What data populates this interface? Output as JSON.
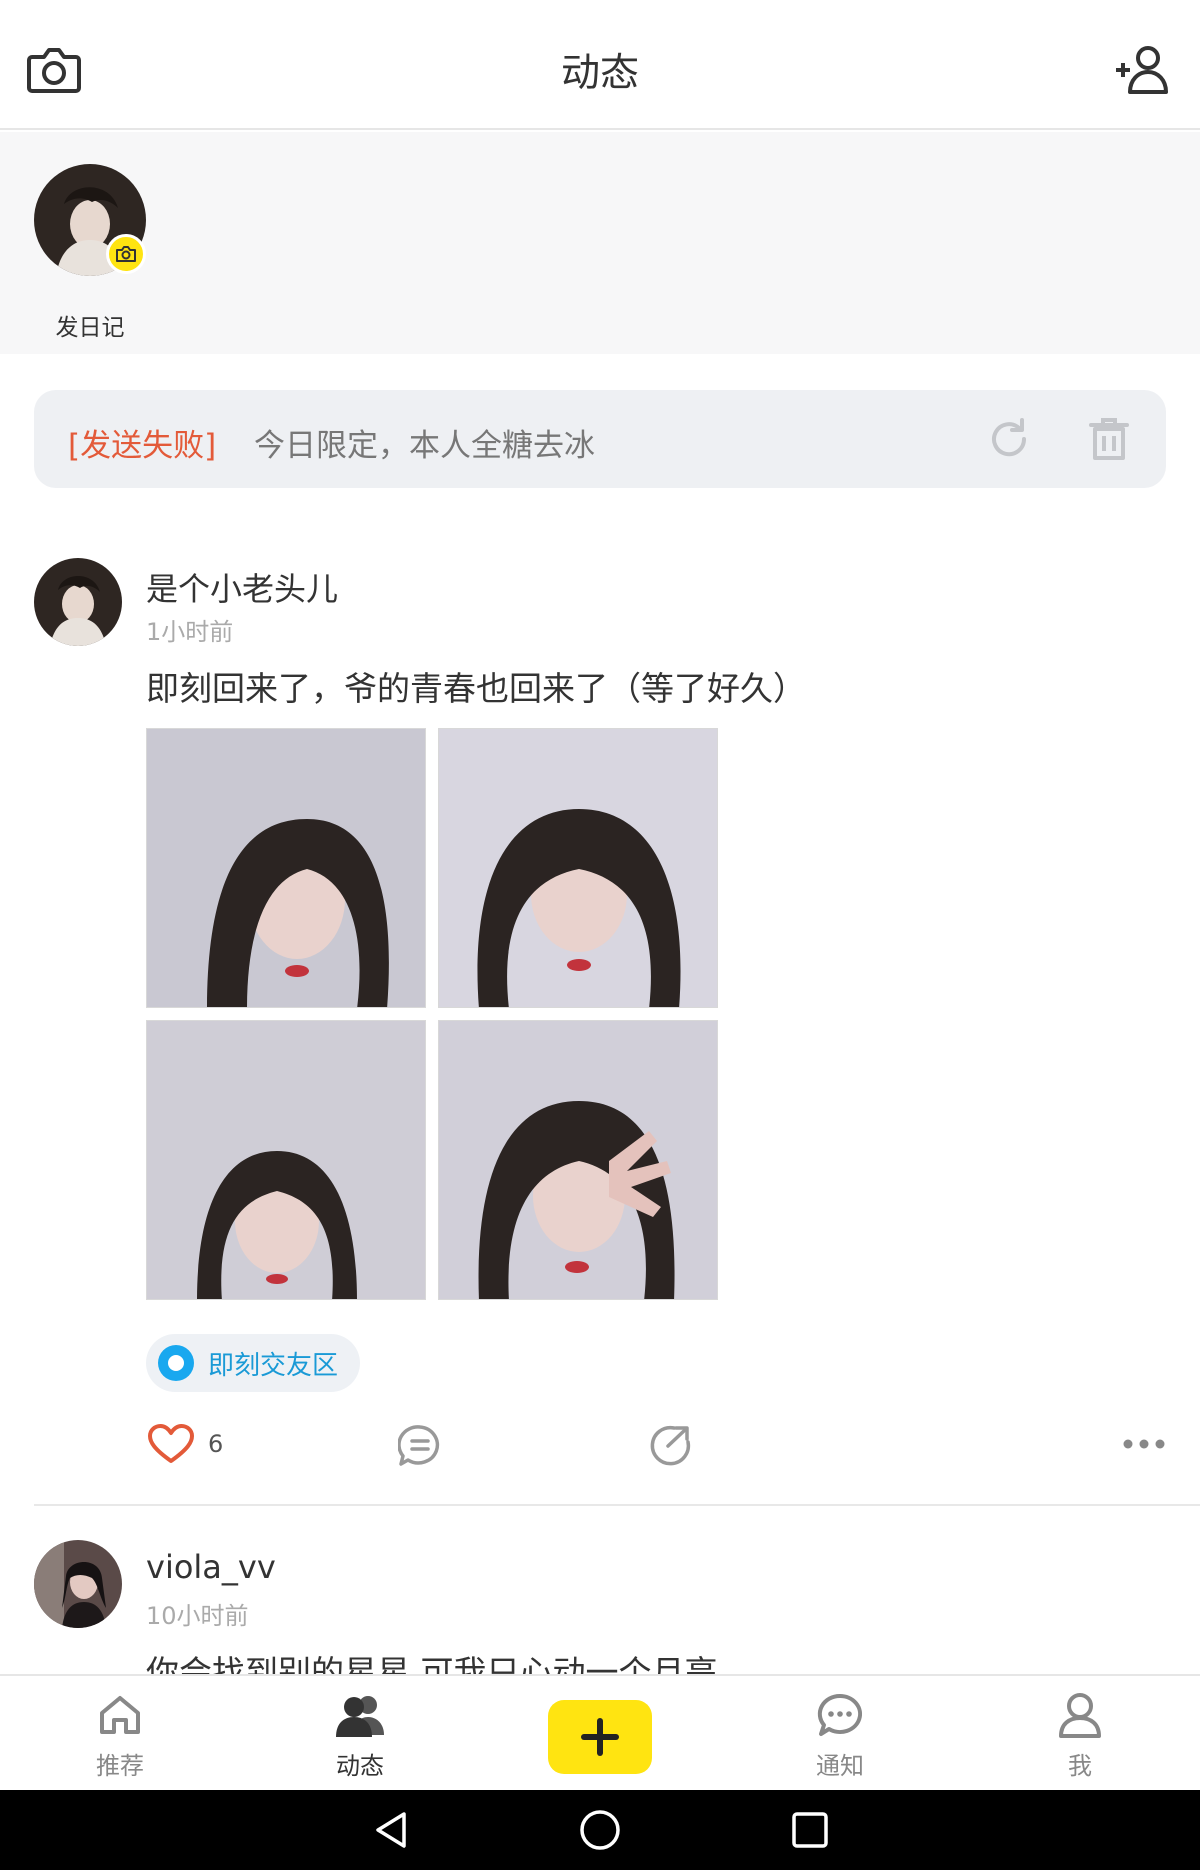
{
  "header": {
    "title": "动态"
  },
  "stories": {
    "label": "发日记"
  },
  "failed_post": {
    "tag": "[发送失败]",
    "message": "今日限定，本人全糖去冰"
  },
  "posts": [
    {
      "username": "是个小老头儿",
      "time": "1小时前",
      "text": "即刻回来了，爷的青春也回来了（等了好久）",
      "topic": "即刻交友区",
      "likes": "6",
      "image_count": 4
    },
    {
      "username": "viola_vv",
      "time": "10小时前",
      "text": "你会找到别的星星 可我只心动一个月亮"
    }
  ],
  "tabs": [
    {
      "label": "推荐",
      "icon": "home-icon"
    },
    {
      "label": "动态",
      "icon": "people-icon"
    },
    {
      "label": "",
      "icon": "plus-icon"
    },
    {
      "label": "通知",
      "icon": "chat-bubble-icon"
    },
    {
      "label": "我",
      "icon": "person-icon"
    }
  ],
  "colors": {
    "accent_yellow": "#ffe411",
    "error_red": "#e35a39",
    "topic_blue": "#19a8ef",
    "like_red": "#e35a39"
  }
}
